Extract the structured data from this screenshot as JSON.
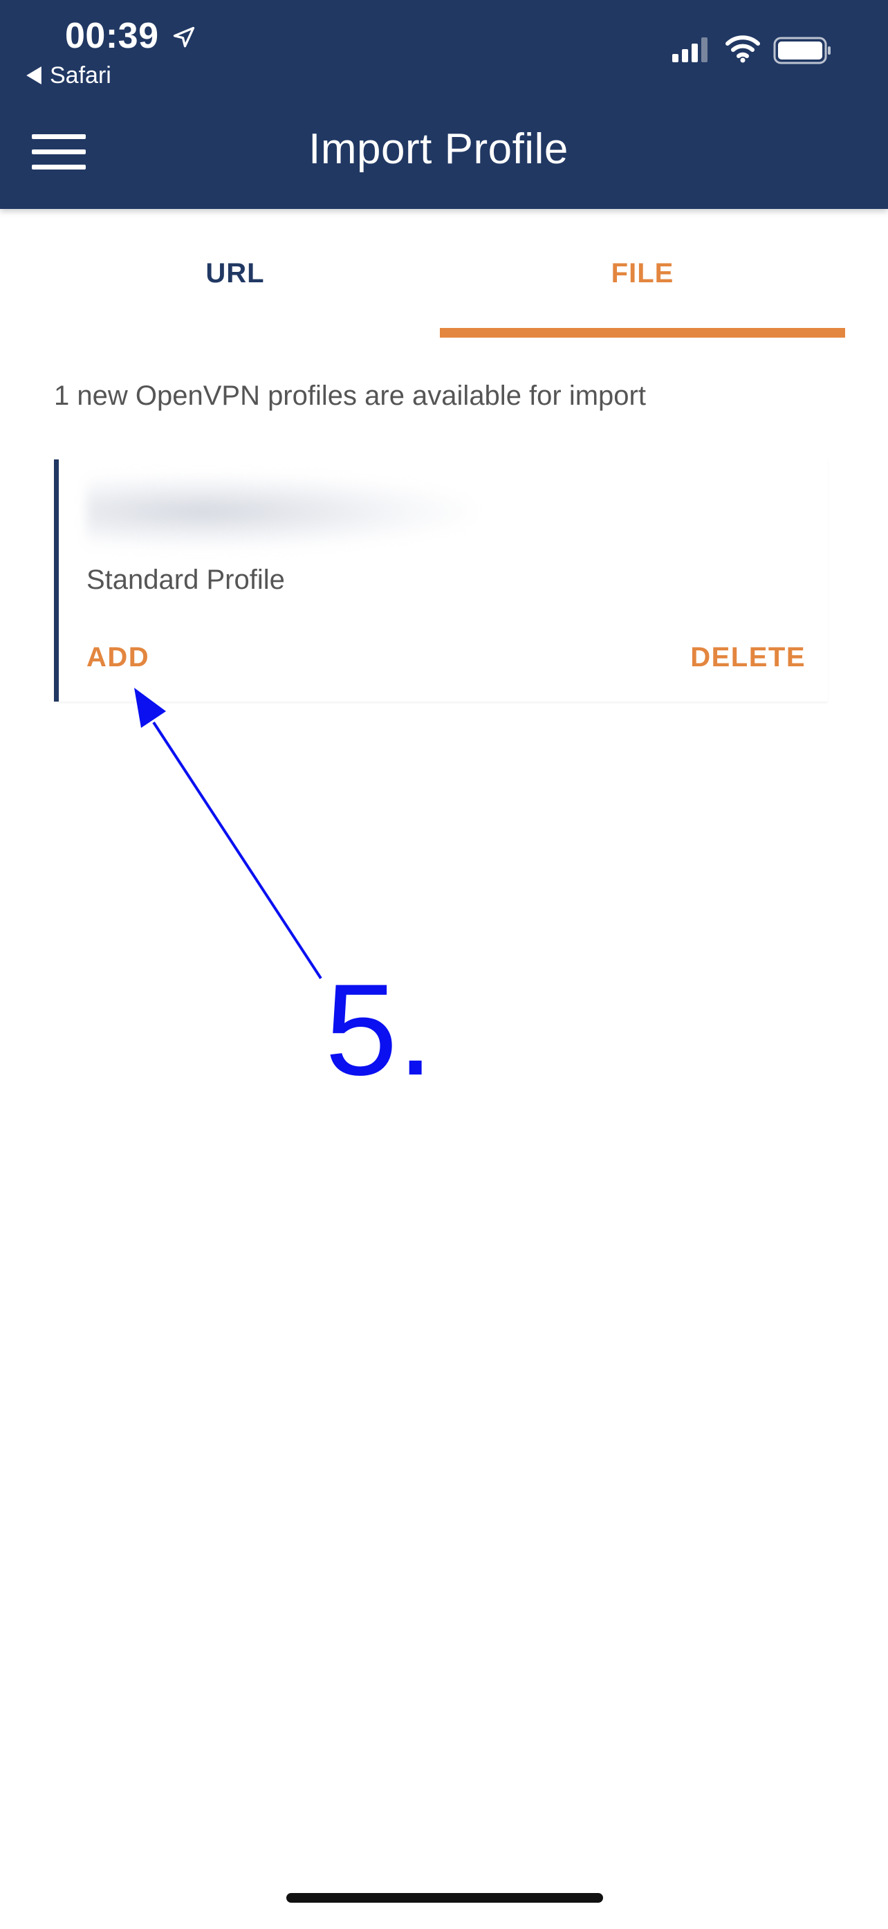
{
  "status_bar": {
    "time": "00:39",
    "back_label": "Safari",
    "icons": [
      "location-icon",
      "signal-icon",
      "wifi-icon",
      "battery-icon"
    ]
  },
  "header": {
    "title": "Import Profile",
    "menu_icon": "hamburger-menu-icon"
  },
  "tabs": [
    {
      "label": "URL",
      "active": false
    },
    {
      "label": "FILE",
      "active": true
    }
  ],
  "info": {
    "text": "1 new OpenVPN profiles are available for import"
  },
  "profile_card": {
    "hostname_blurred": true,
    "subtitle": "Standard Profile",
    "add_label": "ADD",
    "delete_label": "DELETE"
  },
  "annotation": {
    "step_label": "5.",
    "color": "#0a10f0"
  },
  "colors": {
    "header_bg": "#213863",
    "accent": "#e3863f",
    "text_gray": "#555555"
  }
}
